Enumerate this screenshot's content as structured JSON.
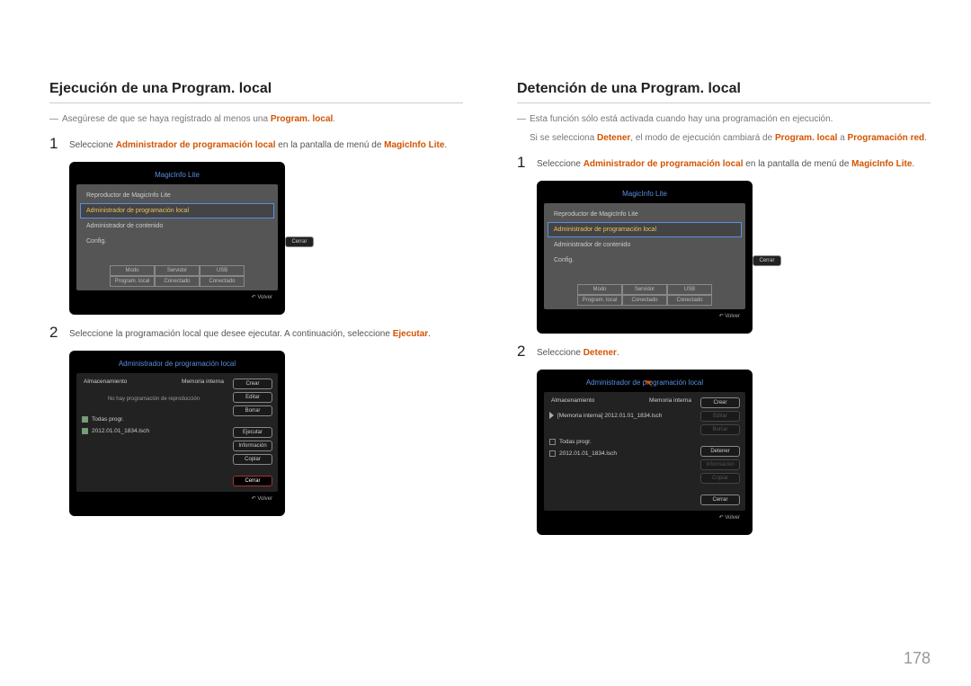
{
  "page_number": "178",
  "left": {
    "heading": "Ejecución de una Program. local",
    "note1_pre": "Asegúrese de que se haya registrado al menos una ",
    "note1_hl": "Program. local",
    "note1_post": ".",
    "step1_pre": "Seleccione ",
    "step1_hl1": "Administrador de programación local",
    "step1_mid": " en la pantalla de menú de ",
    "step1_hl2": "MagicInfo Lite",
    "step1_post": ".",
    "step2_pre": "Seleccione la programación local que desee ejecutar. A continuación, seleccione ",
    "step2_hl": "Ejecutar",
    "step2_post": "."
  },
  "right": {
    "heading": "Detención de una Program. local",
    "note1": "Esta función sólo está activada cuando hay una programación en ejecución.",
    "note2_pre": "Si se selecciona ",
    "note2_hl1": "Detener",
    "note2_mid": ", el modo de ejecución cambiará de ",
    "note2_hl2": "Program. local",
    "note2_mid2": " a ",
    "note2_hl3": "Programación red",
    "note2_post": ".",
    "step1_pre": "Seleccione ",
    "step1_hl1": "Administrador de programación local",
    "step1_mid": " en la pantalla de menú de ",
    "step1_hl2": "MagicInfo Lite",
    "step1_post": ".",
    "step2_pre": "Seleccione ",
    "step2_hl": "Detener",
    "step2_post": "."
  },
  "magicinfo": {
    "title": "MagicInfo Lite",
    "m1": "Reproductor de MagicInfo Lite",
    "m2": "Administrador de programación local",
    "m3": "Administrador de contenido",
    "m4": "Config.",
    "close": "Cerrar",
    "volver": "Volver",
    "status": {
      "h1": "Modo",
      "h2": "Servidor",
      "h3": "USB",
      "v1": "Program. local",
      "v2": "Conectado",
      "v3": "Conectado"
    }
  },
  "admin": {
    "title": "Administrador de programación local",
    "storage": "Almacenamiento",
    "mem": "Memoria interna",
    "no_schedule": "No hay programación de reproducción",
    "running": "[Memoria interna] 2012.01.01_1834.lsch",
    "all": "Todas progr.",
    "file": "2012.01.01_1834.lsch",
    "btns": {
      "crear": "Crear",
      "editar": "Editar",
      "borrar": "Borrar",
      "ejecutar": "Ejecutar",
      "detener": "Detener",
      "info": "Información",
      "copiar": "Copiar",
      "cerrar": "Cerrar"
    }
  }
}
